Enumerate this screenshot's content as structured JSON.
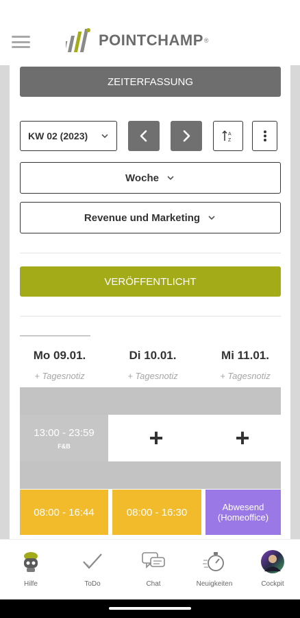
{
  "header": {
    "brand": "POINTCHAMP",
    "brand_reg": "®",
    "menu_icon": "hamburger-icon"
  },
  "toolbar": {
    "zeiterfassung_label": "ZEITERFASSUNG",
    "week_value": "KW 02 (2023)",
    "prev_icon": "chevron-left-icon",
    "next_icon": "chevron-right-icon",
    "sort_icon": "sort-icon",
    "more_icon": "more-vertical-icon"
  },
  "filters": {
    "period_value": "Woche",
    "department_value": "Revenue und Marketing"
  },
  "publish": {
    "label": "VERÖFFENTLICHT",
    "color": "#a3ac18"
  },
  "days": [
    {
      "label": "Mo 09.01.",
      "note": "+ Tagesnotiz"
    },
    {
      "label": "Di 10.01.",
      "note": "+ Tagesnotiz"
    },
    {
      "label": "Mi 11.01.",
      "note": "+ Tagesnotiz"
    }
  ],
  "rows": {
    "row1": [
      {
        "time": "13:00 - 23:59",
        "tag": "F&B",
        "color": "#c6c6c6"
      },
      {
        "add": "+"
      },
      {
        "add": "+"
      }
    ],
    "row2": [
      {
        "time": "08:00 - 16:44",
        "color": "#f2bb2c"
      },
      {
        "time": "08:00 - 16:30",
        "color": "#f2bb2c"
      },
      {
        "line1": "Abwesend",
        "line2": "(Homeoffice)",
        "color": "#9a79e6"
      }
    ]
  },
  "bottom_nav": [
    {
      "label": "Hilfe",
      "icon": "robot-help-icon"
    },
    {
      "label": "ToDo",
      "icon": "checkmark-icon"
    },
    {
      "label": "Chat",
      "icon": "chat-bubbles-icon"
    },
    {
      "label": "Neuigkeiten",
      "icon": "stopwatch-icon"
    },
    {
      "label": "Cockpit",
      "icon": "avatar-icon"
    }
  ]
}
